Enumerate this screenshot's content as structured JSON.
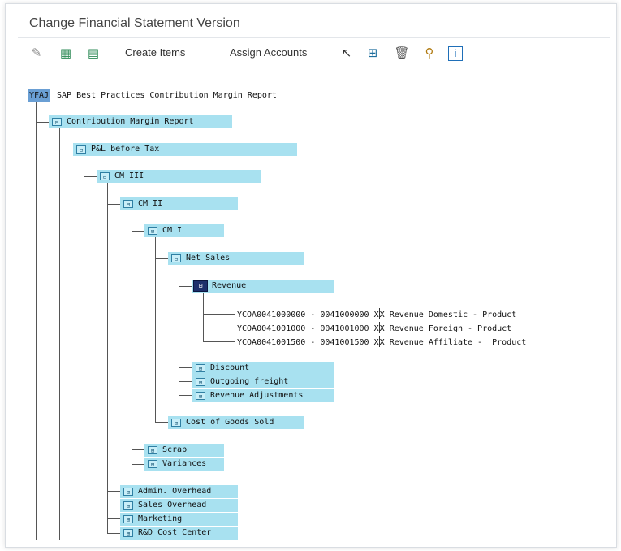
{
  "window": {
    "title": "Change Financial Statement Version"
  },
  "toolbar": {
    "create_items": "Create Items",
    "assign_accounts": "Assign Accounts",
    "icons": [
      "display-change-icon",
      "select-icon",
      "deselect-icon",
      "expand-icon",
      "assign-icon",
      "delete-icon",
      "find-icon",
      "info-icon"
    ]
  },
  "tree": {
    "root_key": "YFAJ",
    "root_label": "SAP Best Practices Contribution Margin Report",
    "nodes": {
      "contribution_margin_report": "Contribution Margin Report",
      "pl_before_tax": "P&L before Tax",
      "cm3": "CM III",
      "cm2": "CM II",
      "cm1": "CM I",
      "net_sales": "Net Sales",
      "revenue": "Revenue",
      "discount": "Discount",
      "outgoing_freight": "Outgoing freight",
      "revenue_adjustments": "Revenue Adjustments",
      "cogs": "Cost of Goods Sold",
      "scrap": "Scrap",
      "variances": "Variances",
      "admin_overhead": "Admin. Overhead",
      "sales_overhead": "Sales Overhead",
      "marketing": "Marketing",
      "rd_cost_center": "R&D Cost Center"
    },
    "accounts": [
      {
        "range": "YCOA0041000000 - 0041000000",
        "d": "X",
        "c": "X",
        "name": "Revenue Domestic - Product"
      },
      {
        "range": "YCOA0041001000 - 0041001000",
        "d": "X",
        "c": "X",
        "name": "Revenue Foreign - Product"
      },
      {
        "range": "YCOA0041001500 - 0041001500",
        "d": "X",
        "c": "X",
        "name": "Revenue Affiliate -  Product"
      }
    ]
  }
}
